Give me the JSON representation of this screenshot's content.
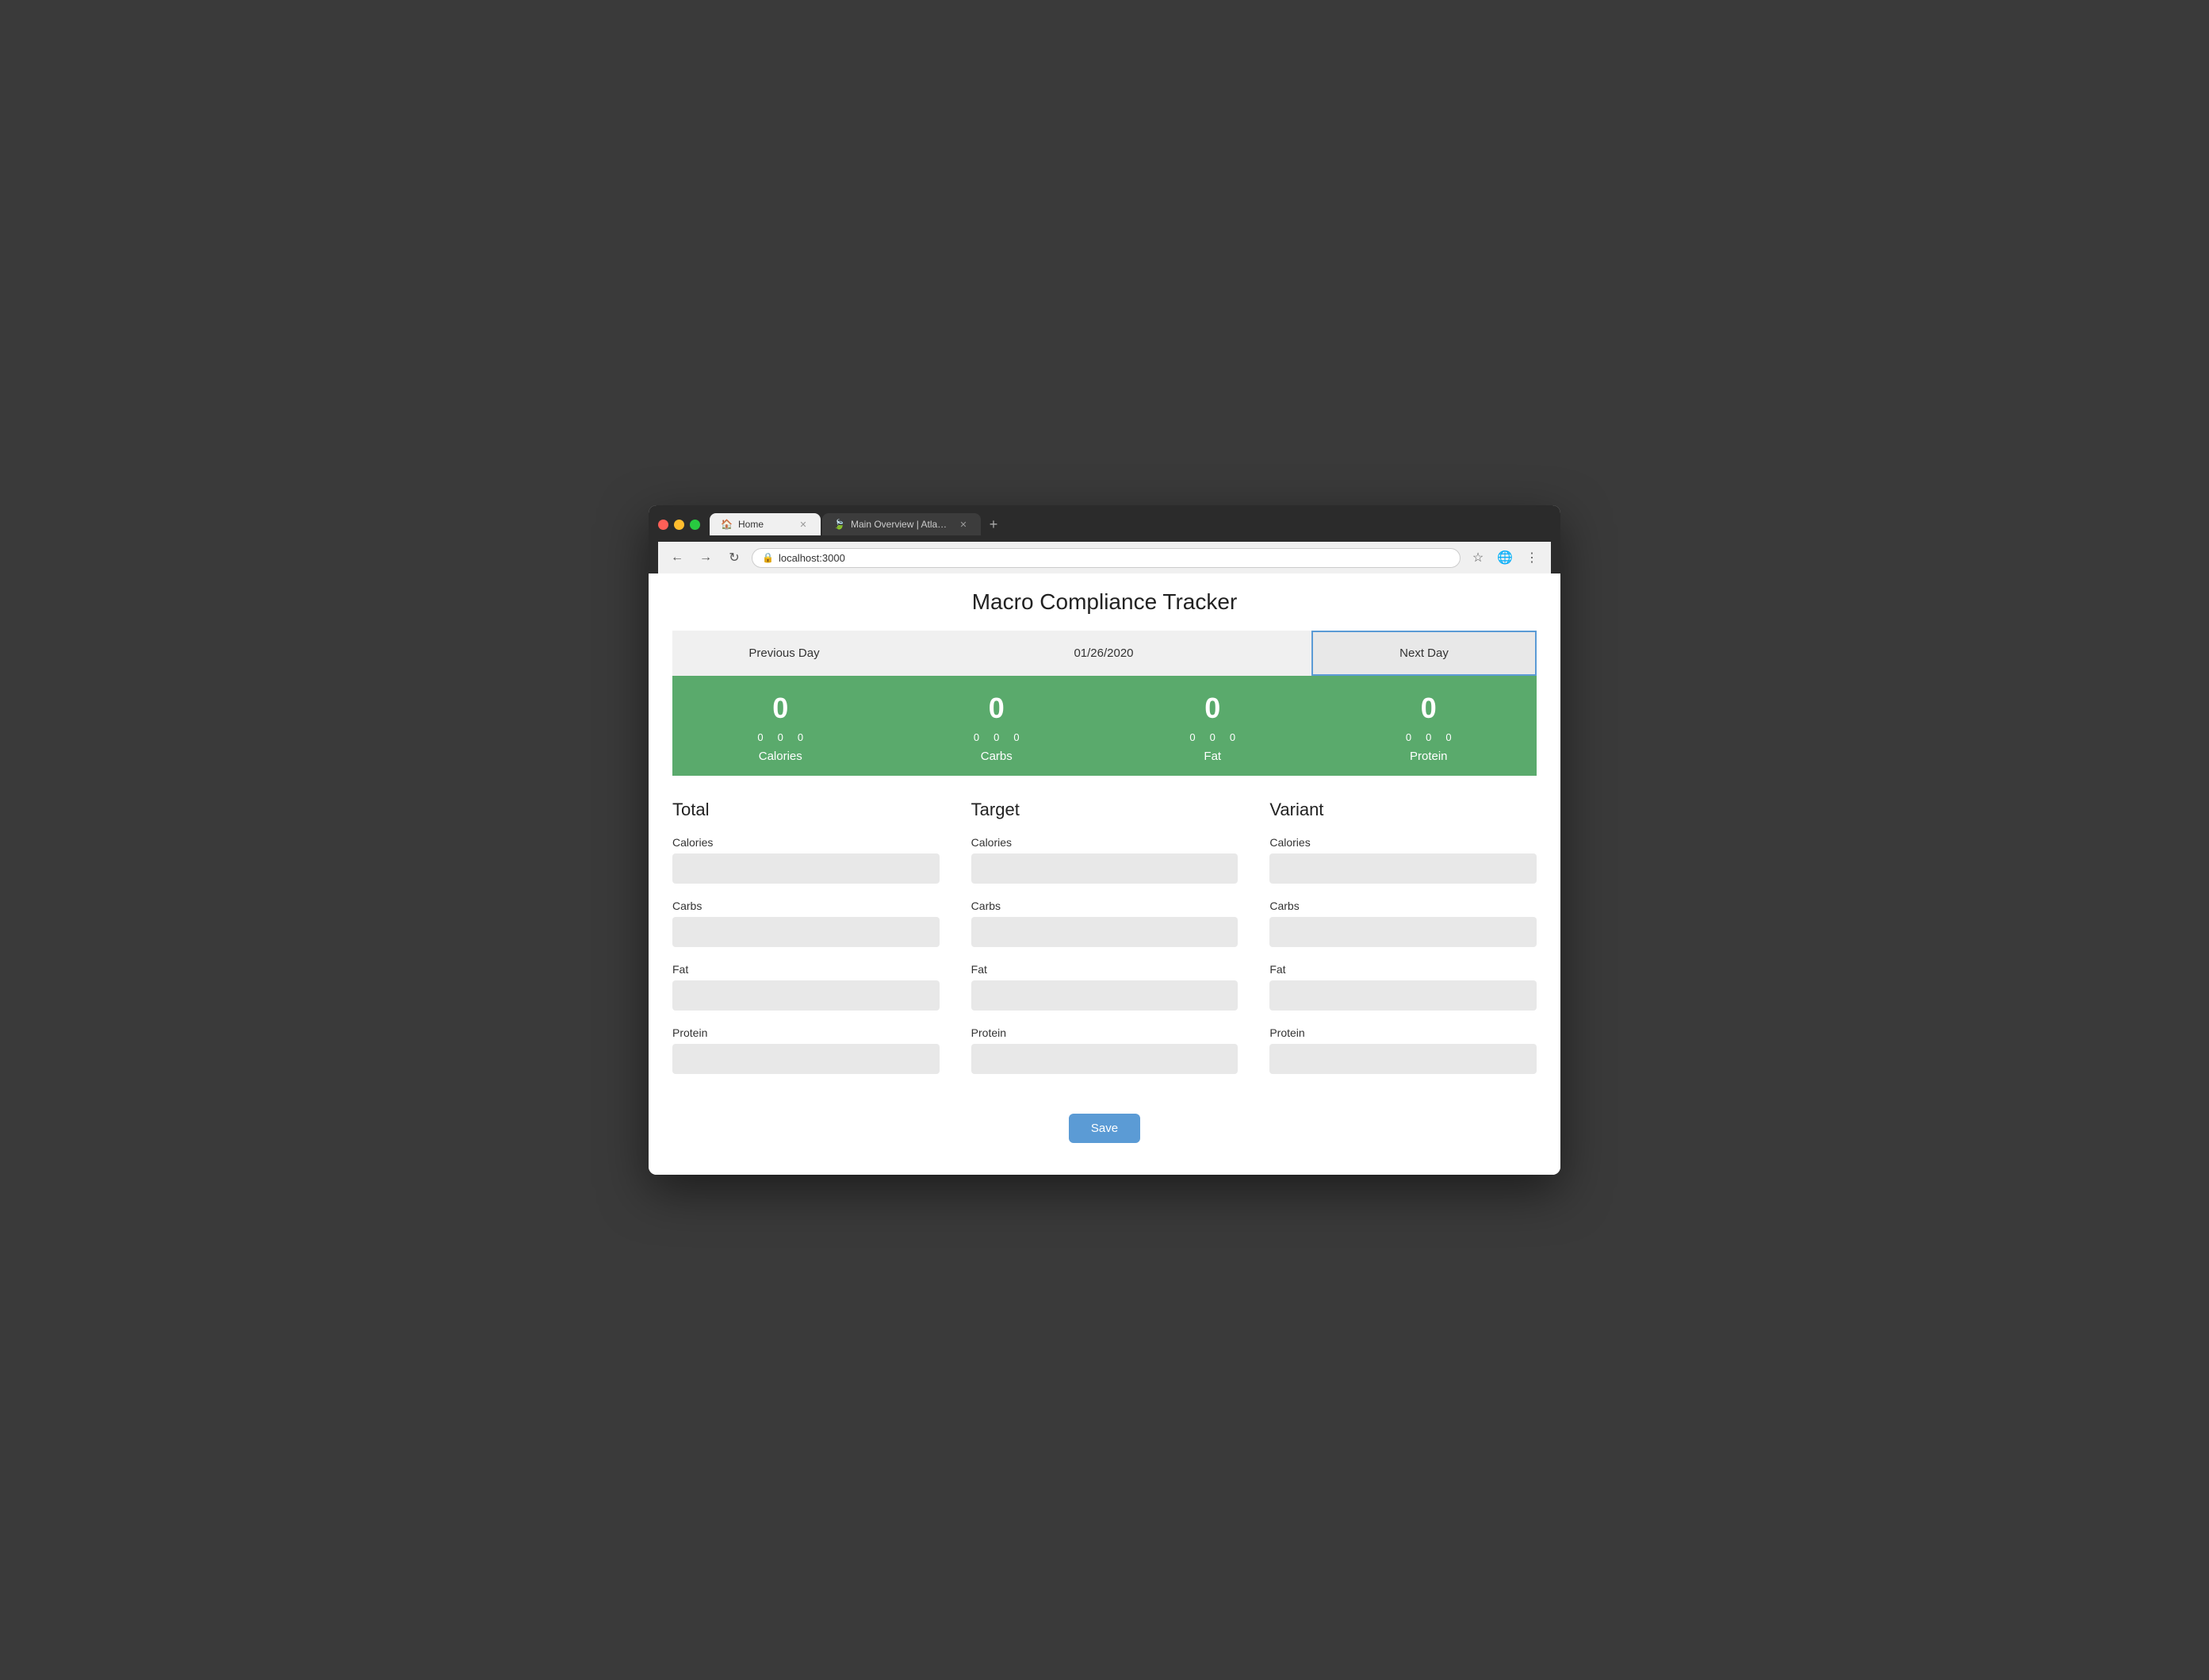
{
  "browser": {
    "tabs": [
      {
        "id": "tab-home",
        "title": "Home",
        "active": true,
        "favicon": "🏠"
      },
      {
        "id": "tab-mongo",
        "title": "Main Overview | Atlas: MongoDB",
        "active": false,
        "favicon": "🍃"
      }
    ],
    "new_tab_label": "+",
    "address_bar": {
      "url": "localhost:3000",
      "lock_icon": "🔒"
    },
    "nav": {
      "back": "←",
      "forward": "→",
      "reload": "↻"
    }
  },
  "page": {
    "title": "Macro Compliance Tracker",
    "day_nav": {
      "previous_label": "Previous Day",
      "date": "01/26/2020",
      "next_label": "Next Day"
    },
    "stats": [
      {
        "id": "calories",
        "main_value": "0",
        "sub_values": [
          "0",
          "0",
          "0"
        ],
        "label": "Calories"
      },
      {
        "id": "carbs",
        "main_value": "0",
        "sub_values": [
          "0",
          "0",
          "0"
        ],
        "label": "Carbs"
      },
      {
        "id": "fat",
        "main_value": "0",
        "sub_values": [
          "0",
          "0",
          "0"
        ],
        "label": "Fat"
      },
      {
        "id": "protein",
        "main_value": "0",
        "sub_values": [
          "0",
          "0",
          "0"
        ],
        "label": "Protein"
      }
    ],
    "form_columns": [
      {
        "id": "total",
        "title": "Total",
        "fields": [
          {
            "id": "total-calories",
            "label": "Calories",
            "value": ""
          },
          {
            "id": "total-carbs",
            "label": "Carbs",
            "value": ""
          },
          {
            "id": "total-fat",
            "label": "Fat",
            "value": ""
          },
          {
            "id": "total-protein",
            "label": "Protein",
            "value": ""
          }
        ]
      },
      {
        "id": "target",
        "title": "Target",
        "fields": [
          {
            "id": "target-calories",
            "label": "Calories",
            "value": ""
          },
          {
            "id": "target-carbs",
            "label": "Carbs",
            "value": ""
          },
          {
            "id": "target-fat",
            "label": "Fat",
            "value": ""
          },
          {
            "id": "target-protein",
            "label": "Protein",
            "value": ""
          }
        ]
      },
      {
        "id": "variant",
        "title": "Variant",
        "fields": [
          {
            "id": "variant-calories",
            "label": "Calories",
            "value": ""
          },
          {
            "id": "variant-carbs",
            "label": "Carbs",
            "value": ""
          },
          {
            "id": "variant-fat",
            "label": "Fat",
            "value": ""
          },
          {
            "id": "variant-protein",
            "label": "Protein",
            "value": ""
          }
        ]
      }
    ],
    "save_button_label": "Save"
  }
}
